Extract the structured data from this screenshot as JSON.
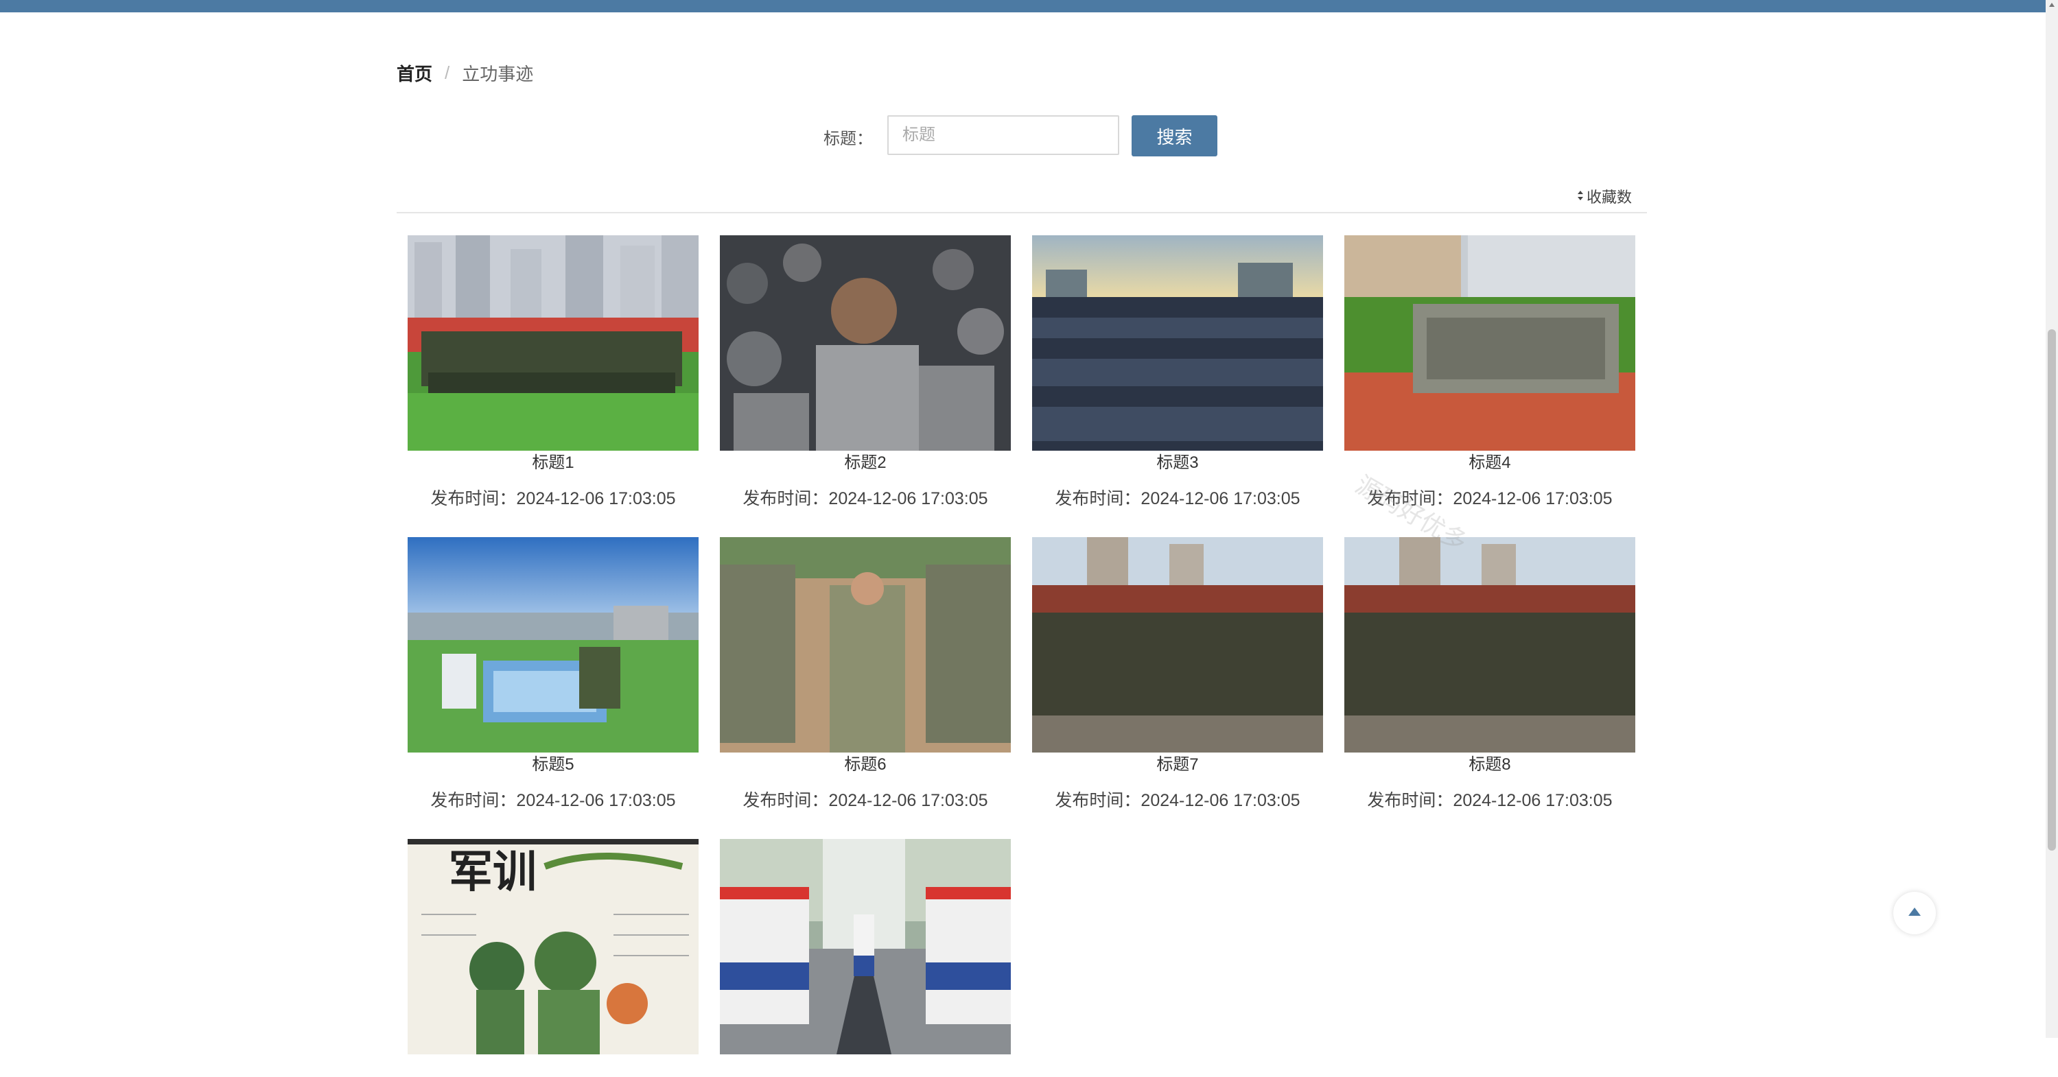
{
  "breadcrumb": {
    "home": "首页",
    "separator": "/",
    "current": "立功事迹"
  },
  "search": {
    "label": "标题：",
    "placeholder": "标题",
    "value": "",
    "button_label": "搜索"
  },
  "sort": {
    "label": "收藏数",
    "icon": "sort-icon"
  },
  "items": [
    {
      "title": "标题1",
      "time": "发布时间：2024-12-06 17:03:05",
      "scene": "troops-on-field"
    },
    {
      "title": "标题2",
      "time": "发布时间：2024-12-06 17:03:05",
      "scene": "seated-students"
    },
    {
      "title": "标题3",
      "time": "发布时间：2024-12-06 17:03:05",
      "scene": "crowd-sunset"
    },
    {
      "title": "标题4",
      "time": "发布时间：2024-12-06 17:03:05",
      "scene": "seated-field-track"
    },
    {
      "title": "标题5",
      "time": "发布时间：2024-12-06 17:03:05",
      "scene": "folding-uniforms"
    },
    {
      "title": "标题6",
      "time": "发布时间：2024-12-06 17:03:05",
      "scene": "marching-rows"
    },
    {
      "title": "标题7",
      "time": "发布时间：2024-12-06 17:03:05",
      "scene": "standing-line-red"
    },
    {
      "title": "标题8",
      "time": "发布时间：2024-12-06 17:03:05",
      "scene": "standing-line-red"
    },
    {
      "title": "",
      "time": "",
      "scene": "cartoon-poster",
      "poster_text": "军训"
    },
    {
      "title": "",
      "time": "",
      "scene": "honor-guard"
    }
  ],
  "watermark": "源码好优多",
  "colors": {
    "accent": "#4c7aa3",
    "topbar": "#4c7aa3"
  }
}
